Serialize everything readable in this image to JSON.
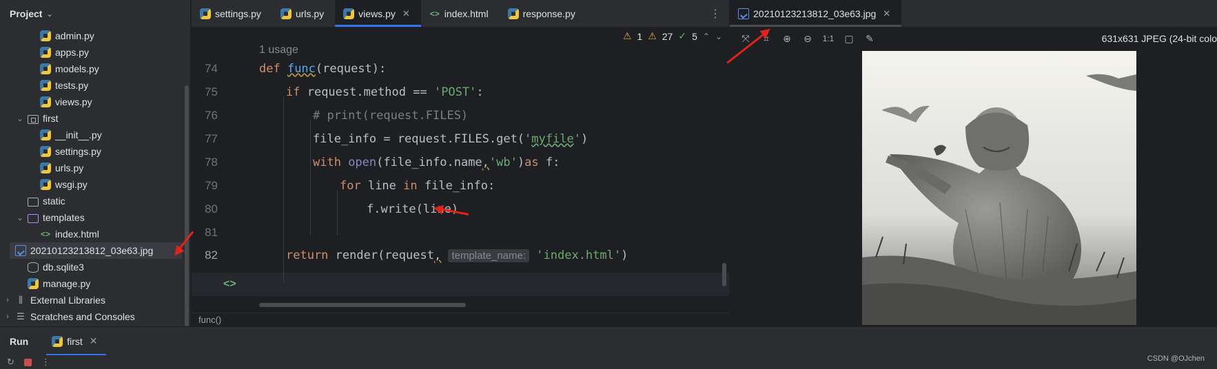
{
  "project": {
    "title": "Project",
    "tree": [
      {
        "label": "admin.py",
        "indent": 3,
        "icon": "python-file-icon",
        "arrow": ""
      },
      {
        "label": "apps.py",
        "indent": 3,
        "icon": "python-file-icon",
        "arrow": ""
      },
      {
        "label": "models.py",
        "indent": 3,
        "icon": "python-file-icon",
        "arrow": ""
      },
      {
        "label": "tests.py",
        "indent": 3,
        "icon": "python-file-icon",
        "arrow": ""
      },
      {
        "label": "views.py",
        "indent": 3,
        "icon": "python-file-icon",
        "arrow": ""
      },
      {
        "label": "first",
        "indent": 2,
        "icon": "package-folder-icon",
        "arrow": "open"
      },
      {
        "label": "__init__.py",
        "indent": 3,
        "icon": "python-file-icon",
        "arrow": ""
      },
      {
        "label": "settings.py",
        "indent": 3,
        "icon": "python-file-icon",
        "arrow": ""
      },
      {
        "label": "urls.py",
        "indent": 3,
        "icon": "python-file-icon",
        "arrow": ""
      },
      {
        "label": "wsgi.py",
        "indent": 3,
        "icon": "python-file-icon",
        "arrow": ""
      },
      {
        "label": "static",
        "indent": 2,
        "icon": "folder-icon",
        "arrow": ""
      },
      {
        "label": "templates",
        "indent": 2,
        "icon": "templates-folder-icon",
        "arrow": "open"
      },
      {
        "label": "index.html",
        "indent": 3,
        "icon": "html-file-icon",
        "arrow": ""
      },
      {
        "label": "20210123213812_03e63.jpg",
        "indent": 2,
        "icon": "image-file-icon",
        "arrow": "",
        "selected": true
      },
      {
        "label": "db.sqlite3",
        "indent": 2,
        "icon": "database-icon",
        "arrow": ""
      },
      {
        "label": "manage.py",
        "indent": 2,
        "icon": "python-file-icon",
        "arrow": ""
      },
      {
        "label": "External Libraries",
        "indent": 1,
        "icon": "library-icon",
        "arrow": "closed"
      },
      {
        "label": "Scratches and Consoles",
        "indent": 1,
        "icon": "scratches-icon",
        "arrow": "closed"
      }
    ]
  },
  "editor": {
    "tabs": [
      {
        "label": "settings.py",
        "icon": "python-file-icon",
        "active": false
      },
      {
        "label": "urls.py",
        "icon": "python-file-icon",
        "active": false
      },
      {
        "label": "views.py",
        "icon": "python-file-icon",
        "active": true
      },
      {
        "label": "index.html",
        "icon": "html-file-icon",
        "active": false
      },
      {
        "label": "response.py",
        "icon": "python-file-icon",
        "active": false
      }
    ],
    "inspections": {
      "warnings_a": "1",
      "warnings_b": "27",
      "ok": "5"
    },
    "usages": "1 usage",
    "line_numbers": [
      "74",
      "75",
      "76",
      "77",
      "78",
      "79",
      "80",
      "81",
      "82"
    ],
    "current_line": "82",
    "breadcrumb": "func()",
    "code": {
      "l74_def": "def ",
      "l74_name": "func",
      "l74_rest": "(request):",
      "l75_if": "if ",
      "l75_mid": "request.method == ",
      "l75_str": "'POST'",
      "l75_end": ":",
      "l76": "# print(request.FILES)",
      "l77_a": "file_info = request.FILES.get(",
      "l77_q1": "'",
      "l77_str": "myfile",
      "l77_q2": "'",
      "l77_b": ")",
      "l78_with": "with ",
      "l78_open": "open",
      "l78_a": "(file_info.name",
      "l78_comma": ",",
      "l78_str": "'wb'",
      "l78_b": ")",
      "l78_as": "as ",
      "l78_c": "f:",
      "l79_for": "for ",
      "l79_a": "line ",
      "l79_in": "in ",
      "l79_b": "file_info:",
      "l80": "f.write(line)",
      "l82_return": "return ",
      "l82_a": "render(request",
      "l82_comma": ",",
      "l82_hint": "template_name:",
      "l82_str": "'index.html'",
      "l82_b": ")"
    }
  },
  "viewer": {
    "tab_label": "20210123213812_03e63.jpg",
    "info": "631x631 JPEG (24-bit colo",
    "zoom_label": "1:1"
  },
  "run": {
    "label": "Run",
    "tab_label": "first"
  },
  "watermark": "CSDN @OJchen",
  "colors": {
    "accent": "#3574f0",
    "annotation_arrow": "#e2231a"
  }
}
